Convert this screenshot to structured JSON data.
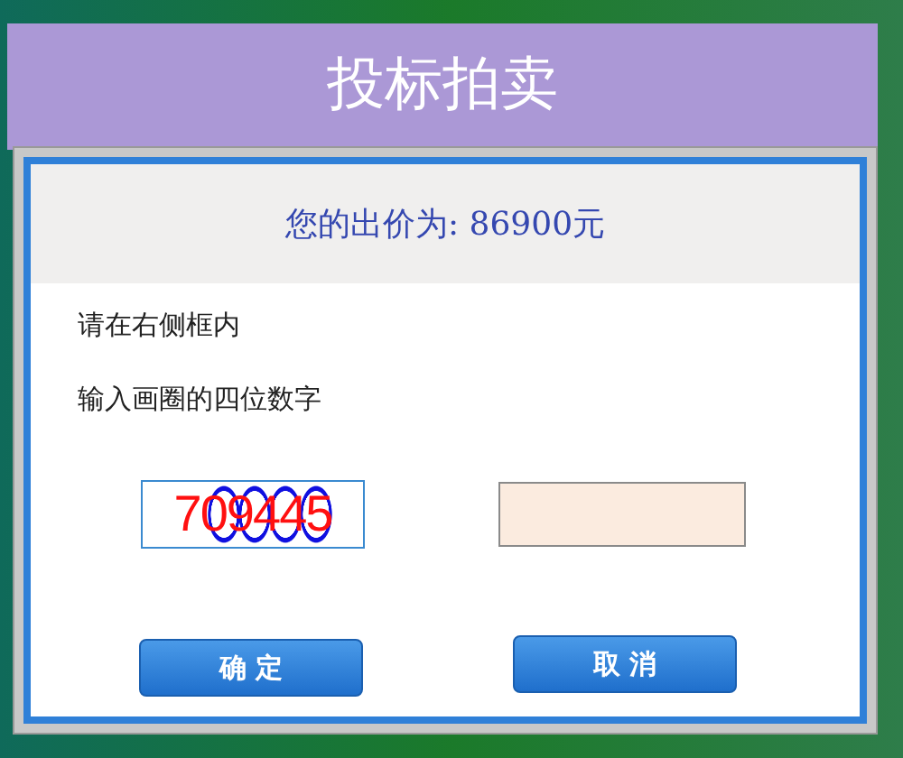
{
  "page": {
    "title": "投标拍卖"
  },
  "dialog": {
    "price_line": "您的出价为: 86900元",
    "instructions": [
      "请在右侧框内",
      "输入画圈的四位数字"
    ],
    "captcha": {
      "text": "709445"
    },
    "buttons": [
      "确 定",
      "取 消"
    ]
  }
}
